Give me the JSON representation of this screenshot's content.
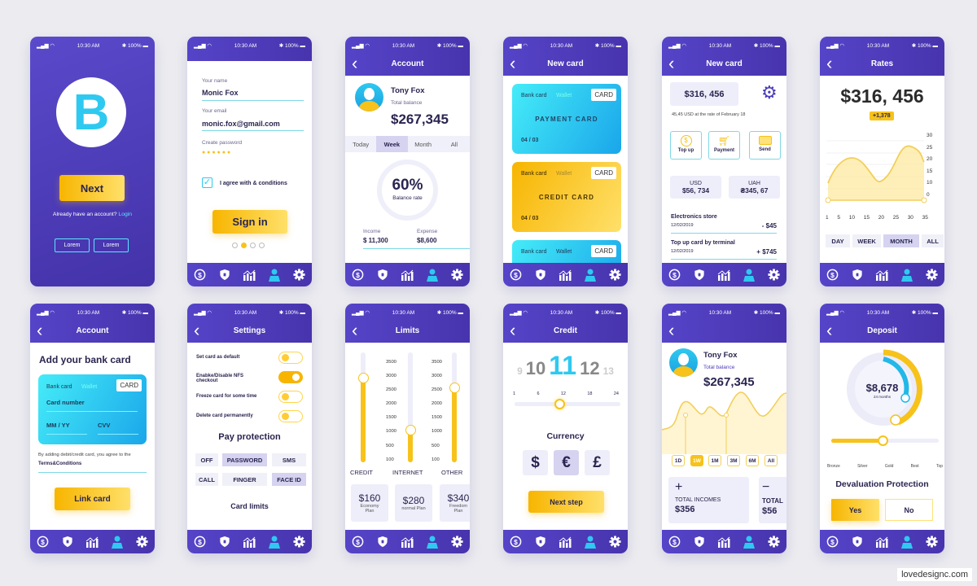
{
  "common": {
    "time": "10:30 AM",
    "battery": "100%",
    "nav_icons": [
      "dollar-icon",
      "shield-icon",
      "chart-icon",
      "user-icon",
      "gear-icon"
    ]
  },
  "colors": {
    "primary": "#4b3cb8",
    "accent_yellow": "#f7b500",
    "accent_cyan": "#1fb8ee"
  },
  "splash": {
    "logo_letter": "B",
    "next": "Next",
    "have_account": "Already have an account?",
    "login": "Login",
    "btn1": "Lorem",
    "btn2": "Lorem"
  },
  "signup": {
    "name_label": "Your name",
    "name_value": "Monic Fox",
    "email_label": "Your email",
    "email_value": "monic.fox@gmail.com",
    "password_label": "Create password",
    "password_dots": "● ● ● ● ● ●",
    "agree": "I agree with & conditions",
    "sign_in": "Sign in"
  },
  "account": {
    "title": "Account",
    "name": "Tony Fox",
    "balance_label": "Total balance",
    "balance": "$267,345",
    "tabs": [
      "Today",
      "Week",
      "Month",
      "All"
    ],
    "active_tab": "Week",
    "rate": "60%",
    "rate_label": "Balance rate",
    "income_label": "Income",
    "income": "$ 11,300",
    "expense_label": "Expense",
    "expense": "$8,600"
  },
  "newcard": {
    "title": "New card",
    "cards": [
      {
        "tab1": "Bank card",
        "tab2": "Wallet",
        "tag": "CARD",
        "name": "PAYMENT CARD",
        "date": "04 / 03"
      },
      {
        "tab1": "Bank card",
        "tab2": "Wallet",
        "tag": "CARD",
        "name": "CREDIT CARD",
        "date": "04 / 03"
      },
      {
        "tab1": "Bank card",
        "tab2": "Wallet",
        "tag": "CARD"
      }
    ]
  },
  "newcard2": {
    "title": "New card",
    "balance": "$316, 456",
    "rate_note": "45,45 USD at the rate of February 18",
    "actions": [
      "Top up",
      "Payment",
      "Send"
    ],
    "usd_label": "USD",
    "usd": "$56, 734",
    "uah_label": "UAH",
    "uah": "₴345, 67",
    "transactions": [
      {
        "name": "Electronics store",
        "date": "12/02/2019",
        "amount": "- $45"
      },
      {
        "name": "Top up card by terminal",
        "date": "12/02/2019",
        "amount": "+ $745"
      }
    ]
  },
  "rates": {
    "title": "Rates",
    "amount": "$316, 456",
    "change": "+1,378",
    "y_ticks": [
      "30",
      "25",
      "20",
      "15",
      "10",
      "0"
    ],
    "x_ticks": [
      "1",
      "5",
      "10",
      "15",
      "20",
      "25",
      "30",
      "35"
    ],
    "periods": [
      "DAY",
      "WEEK",
      "MONTH",
      "ALL"
    ],
    "active_period": "MONTH"
  },
  "bankcard": {
    "title": "Account",
    "heading": "Add your bank card",
    "tab1": "Bank card",
    "tab2": "Wallet",
    "tag": "CARD",
    "number": "Card number",
    "expiry": "MM / YY",
    "cvv": "CVV",
    "terms_text": "By adding debit/credit card, you agree to the",
    "terms_link": "Terms&Conditions",
    "link": "Link card"
  },
  "settings": {
    "title": "Settings",
    "toggles": [
      {
        "label": "Set card as default",
        "on": false
      },
      {
        "label": "Enabke/Disable NFS checkout",
        "on": true
      },
      {
        "label": "Freeze card for some time",
        "on": false
      },
      {
        "label": "Delete card permanently",
        "on": false
      }
    ],
    "pay_title": "Pay protection",
    "options": [
      "OFF",
      "PASSWORD",
      "SMS",
      "CALL",
      "FINGER",
      "FACE ID"
    ],
    "selected": [
      "PASSWORD",
      "FACE ID"
    ],
    "limits": "Card limits"
  },
  "limits": {
    "title": "Limits",
    "scale": [
      "3500",
      "3000",
      "2500",
      "2000",
      "1500",
      "1000",
      "500",
      "100"
    ],
    "sliders": [
      {
        "label": "CREDIT",
        "value": 2700
      },
      {
        "label": "INTERNET",
        "value": 1100
      },
      {
        "label": "OTHER",
        "value": 2400
      }
    ],
    "plans": [
      {
        "price": "$160",
        "name": "Economy Plan"
      },
      {
        "price": "$280",
        "name": "normal Plan"
      },
      {
        "price": "$340",
        "name": "Freedom Plan"
      }
    ]
  },
  "credit": {
    "title": "Credit",
    "months": [
      "9",
      "10",
      "11",
      "12",
      "13"
    ],
    "selected": "11",
    "scale": [
      "1",
      "6",
      "12",
      "18",
      "24"
    ],
    "currency_title": "Currency",
    "currencies": [
      "$",
      "€",
      "£"
    ],
    "active_currency": "€",
    "next": "Next step"
  },
  "profile": {
    "name": "Tony Fox",
    "balance_label": "Total balance",
    "balance": "$267,345",
    "ranges": [
      "1D",
      "1W",
      "1M",
      "3M",
      "6M",
      "All"
    ],
    "active_range": "1W",
    "incomes_sign": "+",
    "incomes_label": "TOTAL INCOMES",
    "incomes": "$356",
    "expenses_sign": "−",
    "expenses_label": "TOTAL",
    "expenses": "$56"
  },
  "deposit": {
    "title": "Deposit",
    "amount": "$8,678",
    "term": "24 months",
    "levels": [
      "Bronze",
      "Silver",
      "Gold",
      "Best",
      "Top"
    ],
    "level": "Gold",
    "protection": "Devaluation Protection",
    "yes": "Yes",
    "no": "No"
  },
  "watermark": "lovedesignc.com"
}
